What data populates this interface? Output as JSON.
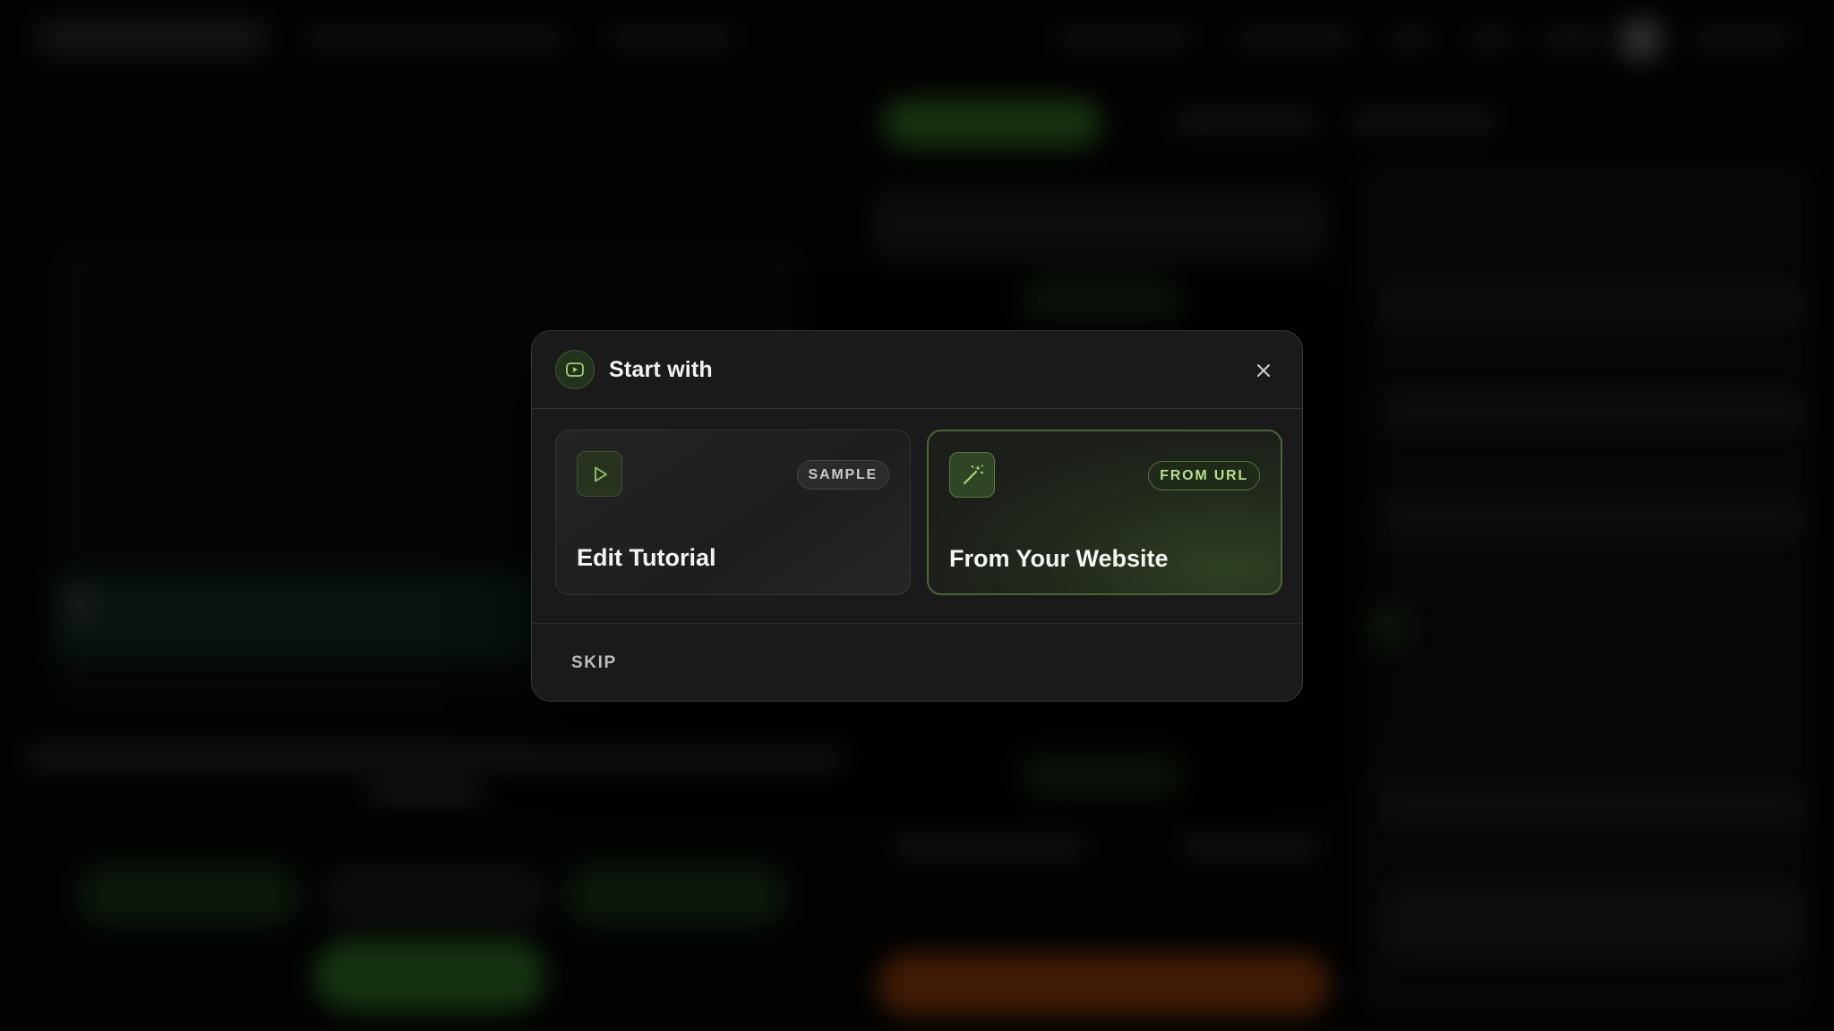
{
  "modal": {
    "title": "Start with",
    "header_icon": "play-circle-icon",
    "close_icon": "close-icon",
    "cards": [
      {
        "badge": "SAMPLE",
        "title": "Edit Tutorial",
        "icon": "play-icon"
      },
      {
        "badge": "FROM URL",
        "title": "From Your Website",
        "icon": "magic-wand-icon"
      }
    ],
    "skip_label": "SKIP"
  },
  "colors": {
    "accent_green": "#b6df8e",
    "background": "#050505",
    "modal_surface": "#1a1a1a"
  }
}
